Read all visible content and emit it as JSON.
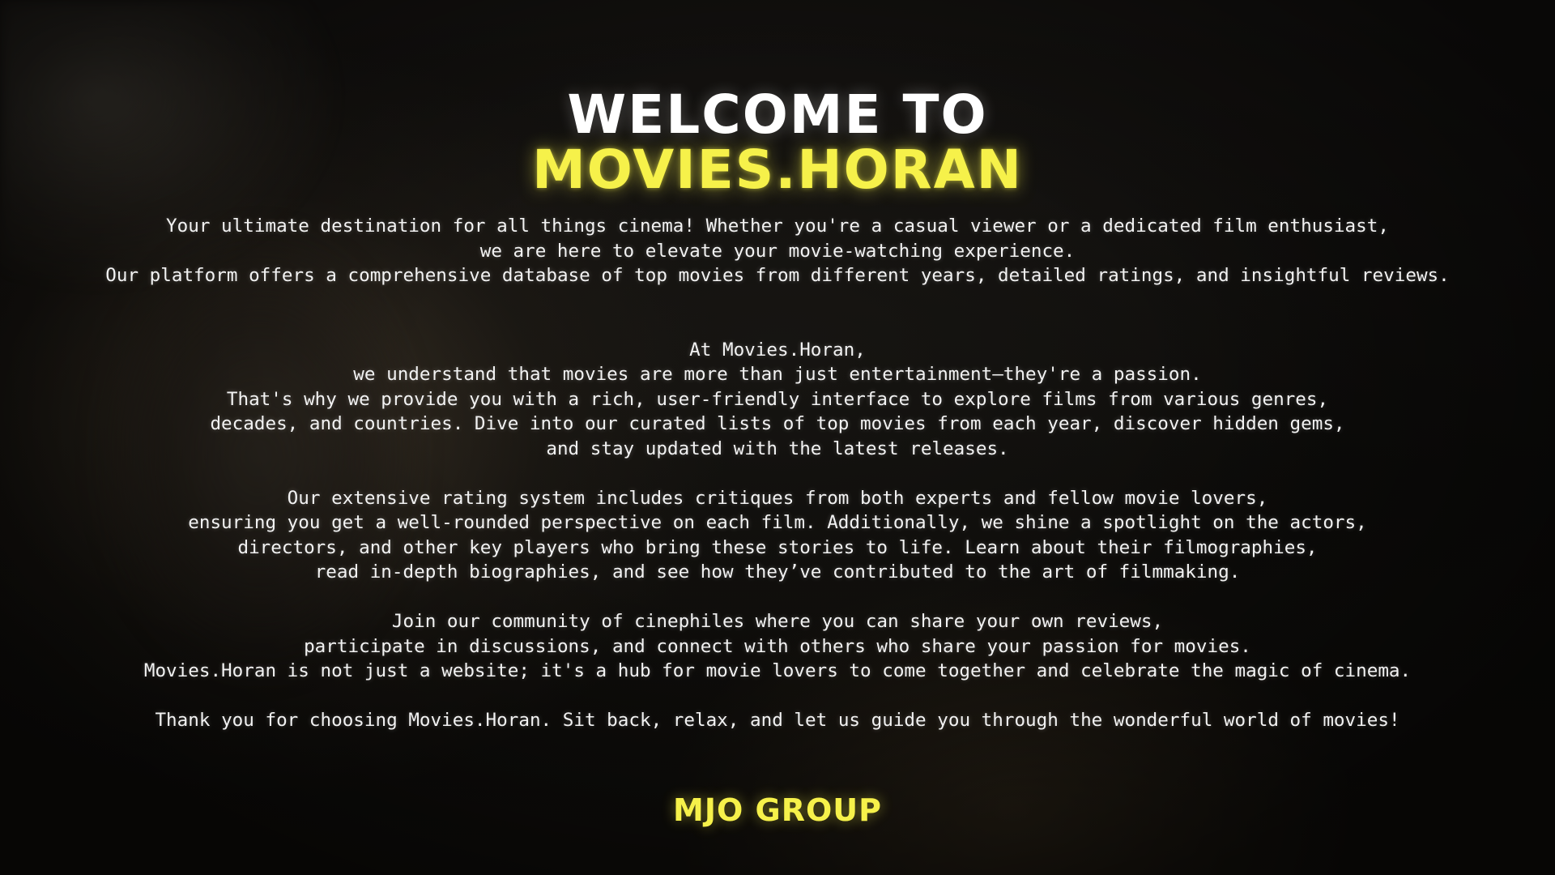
{
  "title": {
    "line1": "WELCOME TO",
    "line2": "MOVIES.HORAN"
  },
  "intro": [
    "Your ultimate destination for all things cinema! Whether you're a casual viewer or a dedicated film enthusiast,",
    "we are here to elevate your movie-watching experience.",
    "Our platform offers a comprehensive database of top movies from different years, detailed ratings, and insightful reviews."
  ],
  "about": [
    "At Movies.Horan,",
    "we understand that movies are more than just entertainment—they're a passion.",
    "That's why we provide you with a rich, user-friendly interface to explore films from various genres,",
    "decades, and countries. Dive into our curated lists of top movies from each year, discover hidden gems,",
    "and stay updated with the latest releases."
  ],
  "ratings": [
    "Our extensive rating system includes critiques from both experts and fellow movie lovers,",
    "ensuring you get a well-rounded perspective on each film. Additionally, we shine a spotlight on the actors,",
    "directors, and other key players who bring these stories to life. Learn about their filmographies,",
    "read in-depth biographies, and see how they’ve contributed to the art of filmmaking."
  ],
  "community": [
    "Join our community of cinephiles where you can share your own reviews,",
    "participate in discussions, and connect with others who share your passion for movies.",
    "Movies.Horan is not just a website; it's a hub for movie lovers to come together and celebrate the magic of cinema."
  ],
  "closing": "Thank you for choosing Movies.Horan. Sit back, relax, and let us guide you through the wonderful world of movies!",
  "footer": {
    "brand": "MJO GROUP"
  },
  "colors": {
    "accent": "#f6f14a",
    "text": "#f2f2f2",
    "background": "#0d0c0a"
  }
}
